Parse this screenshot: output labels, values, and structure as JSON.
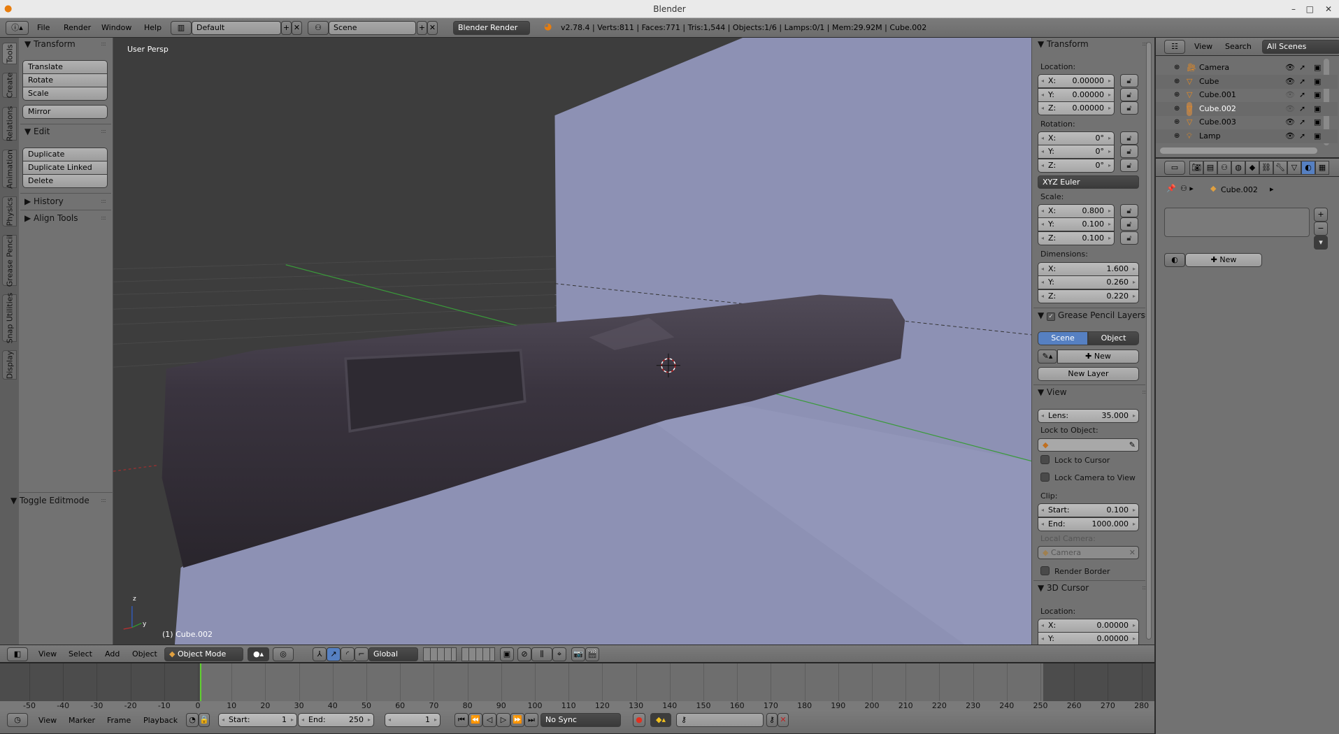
{
  "window": {
    "title": "Blender"
  },
  "topbar": {
    "menus": [
      "File",
      "Render",
      "Window",
      "Help"
    ],
    "layout": "Default",
    "scene": "Scene",
    "engine": "Blender Render",
    "stats": "v2.78.4 | Verts:811 | Faces:771 | Tris:1,544 | Objects:1/6 | Lamps:0/1 | Mem:29.92M | Cube.002"
  },
  "tool_tabs": [
    "Tools",
    "Create",
    "Relations",
    "Animation",
    "Physics",
    "Grease Pencil",
    "Snap Utilities",
    "Display"
  ],
  "toolshelf": {
    "transform_title": "Transform",
    "transform_buttons": [
      "Translate",
      "Rotate",
      "Scale"
    ],
    "mirror": "Mirror",
    "edit_title": "Edit",
    "edit_buttons": [
      "Duplicate",
      "Duplicate Linked",
      "Delete"
    ],
    "history": "History",
    "align_tools": "Align Tools",
    "toggle_editmode": "Toggle Editmode"
  },
  "viewport": {
    "view_name": "User Persp",
    "object_label": "(1) Cube.002",
    "gizmo": {
      "z": "z",
      "y": "y"
    },
    "colors": {
      "background": "#3d3d3d",
      "plane": "#8d91b4",
      "object": "#35303a",
      "y_axis": "#3a9a3a",
      "x_axis": "#a03030"
    }
  },
  "npanel": {
    "axes": [
      "X:",
      "Y:",
      "Z:"
    ],
    "transform": {
      "title": "Transform",
      "location_label": "Location:",
      "location": [
        "0.00000",
        "0.00000",
        "0.00000"
      ],
      "rotation_label": "Rotation:",
      "rotation": [
        "0°",
        "0°",
        "0°"
      ],
      "rotation_mode": "XYZ Euler",
      "scale_label": "Scale:",
      "scale": [
        "0.800",
        "0.100",
        "0.100"
      ],
      "dimensions_label": "Dimensions:",
      "dimensions": [
        "1.600",
        "0.260",
        "0.220"
      ]
    },
    "grease_pencil": {
      "title": "Grease Pencil Layers",
      "enabled": true,
      "tabs": [
        "Scene",
        "Object"
      ],
      "active_tab": "Scene",
      "new": "New",
      "new_layer": "New Layer"
    },
    "view": {
      "title": "View",
      "lens_label": "Lens:",
      "lens": "35.000",
      "lock_to_object": "Lock to Object:",
      "lock_to_cursor": "Lock to Cursor",
      "lock_camera_to_view": "Lock Camera to View",
      "clip_label": "Clip:",
      "clip_start_label": "Start:",
      "clip_start": "0.100",
      "clip_end_label": "End:",
      "clip_end": "1000.000",
      "local_camera_label": "Local Camera:",
      "local_camera": "Camera",
      "render_border": "Render Border"
    },
    "cursor": {
      "title": "3D Cursor",
      "location_label": "Location:",
      "location": [
        "0.00000",
        "0.00000"
      ]
    }
  },
  "outliner": {
    "view": "View",
    "search": "Search",
    "filter": "All Scenes",
    "items": [
      {
        "name": "Camera",
        "icon": "camera-icon",
        "visible": true
      },
      {
        "name": "Cube",
        "icon": "mesh-icon",
        "visible": true
      },
      {
        "name": "Cube.001",
        "icon": "mesh-icon",
        "visible": false
      },
      {
        "name": "Cube.002",
        "icon": "mesh-icon",
        "visible": false,
        "selected": true
      },
      {
        "name": "Cube.003",
        "icon": "mesh-icon",
        "visible": true
      },
      {
        "name": "Lamp",
        "icon": "lamp-icon",
        "visible": true
      }
    ]
  },
  "properties": {
    "active_tab": "material",
    "object": "Cube.002",
    "new": "New"
  },
  "view3d_header": {
    "menus": [
      "View",
      "Select",
      "Add",
      "Object"
    ],
    "mode": "Object Mode",
    "orientation": "Global"
  },
  "timeline": {
    "ticks": [
      "-50",
      "-40",
      "-30",
      "-20",
      "-10",
      "0",
      "10",
      "20",
      "30",
      "40",
      "50",
      "60",
      "70",
      "80",
      "90",
      "100",
      "110",
      "120",
      "130",
      "140",
      "150",
      "160",
      "170",
      "180",
      "190",
      "200",
      "210",
      "220",
      "230",
      "240",
      "250",
      "260",
      "270",
      "280"
    ],
    "menus": [
      "View",
      "Marker",
      "Frame",
      "Playback"
    ],
    "start_label": "Start:",
    "start": "1",
    "end_label": "End:",
    "end": "250",
    "current_frame": "1",
    "sync": "No Sync"
  }
}
